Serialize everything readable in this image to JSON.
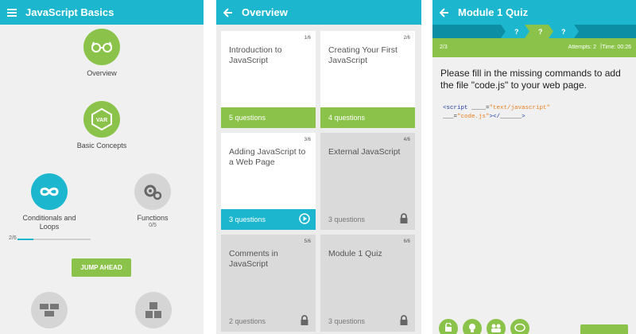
{
  "panel1": {
    "title": "JavaScript Basics",
    "nodes": {
      "overview": {
        "label": "Overview",
        "icon": "glasses-icon"
      },
      "basic_concepts": {
        "label": "Basic Concepts",
        "badge": "VAR",
        "icon": "hexagon-var-icon"
      },
      "conditionals": {
        "label": "Conditionals and\nLoops",
        "icon": "infinity-icon",
        "progress_text": "2/6",
        "progress": 0.22
      },
      "functions": {
        "label": "Functions",
        "sub": "0/5",
        "icon": "gears-icon"
      }
    },
    "jump_label": "JUMP AHEAD"
  },
  "panel2": {
    "title": "Overview",
    "cards": [
      {
        "num": "1/6",
        "title": "Introduction to JavaScript",
        "footer": "5 questions",
        "state": "done"
      },
      {
        "num": "2/6",
        "title": "Creating Your First JavaScript",
        "footer": "4 questions",
        "state": "done"
      },
      {
        "num": "3/6",
        "title": "Adding JavaScript to a Web Page",
        "footer": "3 questions",
        "state": "current"
      },
      {
        "num": "4/6",
        "title": "External JavaScript",
        "footer": "3 questions",
        "state": "locked"
      },
      {
        "num": "5/6",
        "title": "Comments in JavaScript",
        "footer": "2 questions",
        "state": "locked"
      },
      {
        "num": "6/6",
        "title": "Module 1 Quiz",
        "footer": "3 questions",
        "state": "locked"
      }
    ]
  },
  "panel3": {
    "title": "Module 1 Quiz",
    "steps": [
      "?",
      "?",
      "?"
    ],
    "position": "2/3",
    "attempts": "Attempts: 2",
    "separator": "|",
    "time": "Time: 00:26",
    "question": "Please fill in the missing commands to add the file \"code.js\" to your web page.",
    "code": {
      "l1_tag": "<script",
      "l1_blank": " ____=",
      "l1_str": "\"text/javascript\"",
      "l2_blank": "___=",
      "l2_str": "\"code.js\"",
      "l2_tail": "></",
      "l2_blank2": "______",
      "l2_close": ">"
    }
  },
  "colors": {
    "teal": "#1cb7cf",
    "green": "#8bc34a",
    "dark_teal": "#0c8fa4",
    "locked_gray": "#dadada"
  }
}
